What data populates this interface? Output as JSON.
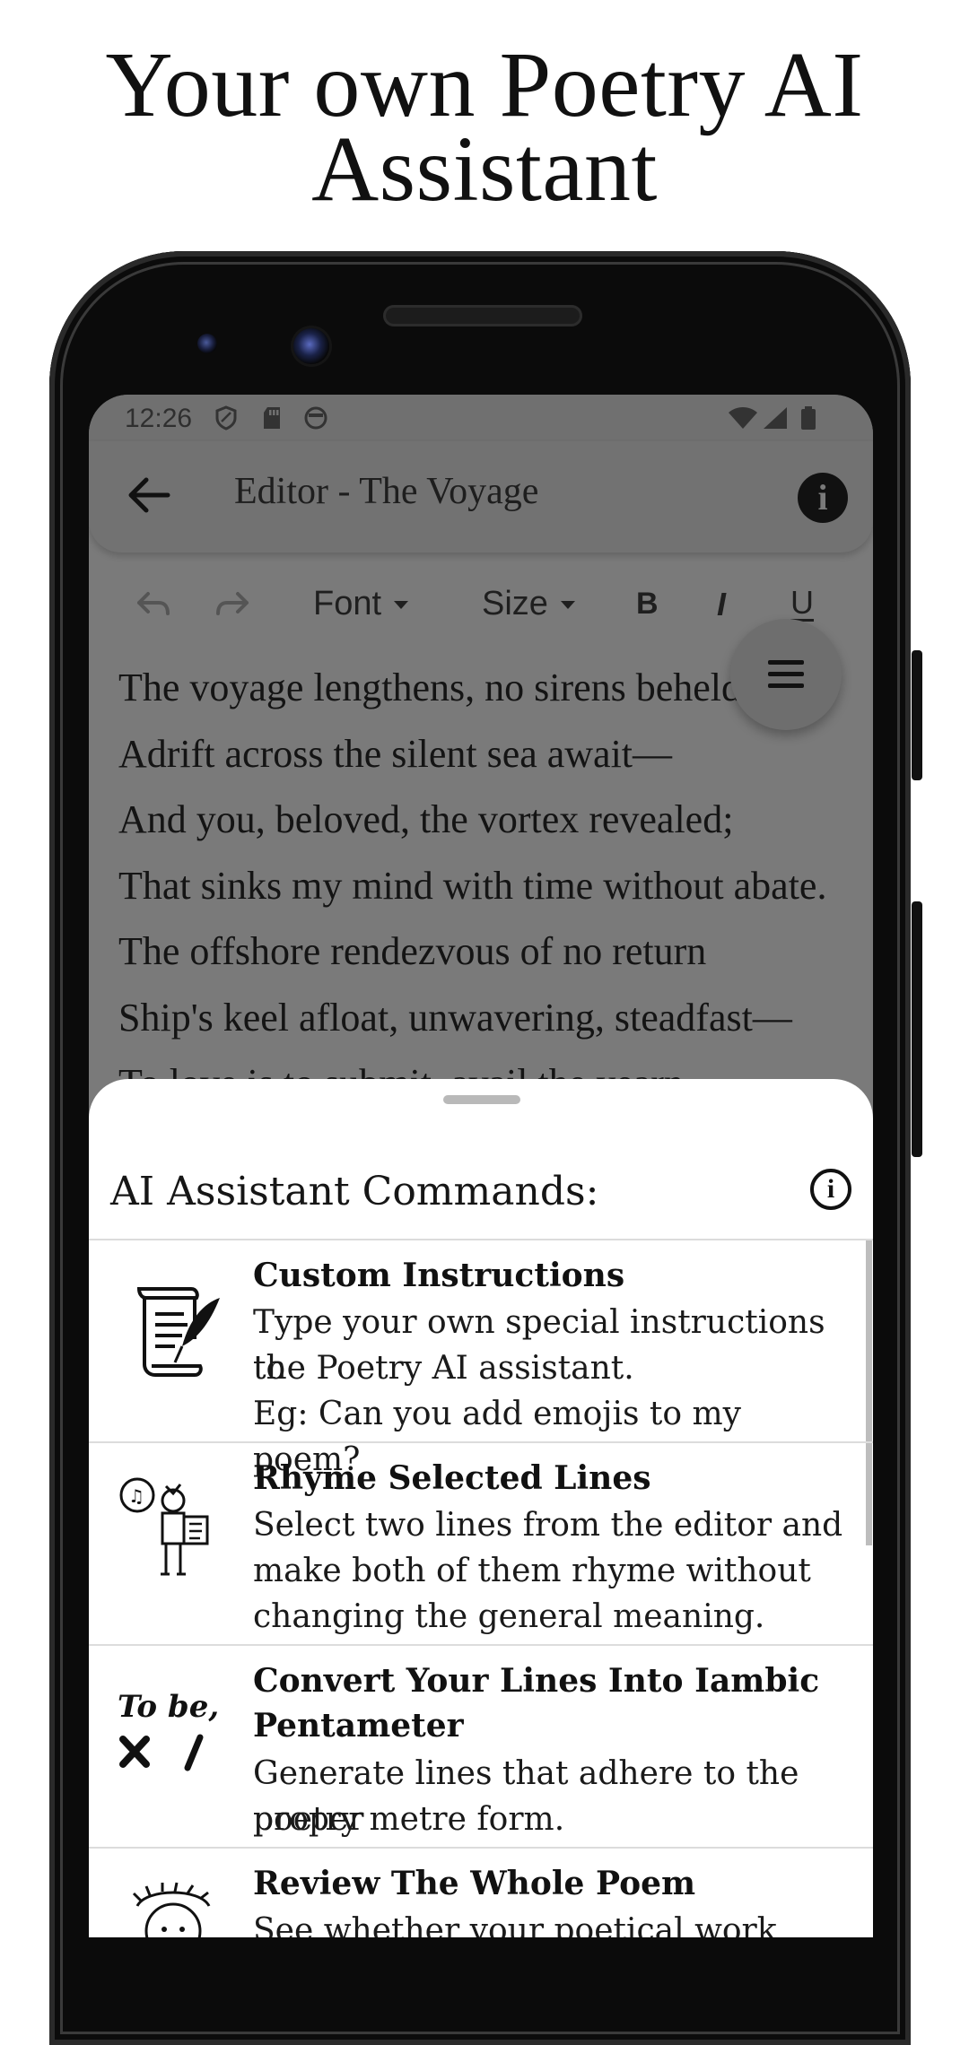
{
  "headline": {
    "line1": "Your own Poetry AI",
    "line2": "Assistant"
  },
  "status_bar": {
    "time": "12:26"
  },
  "app_bar": {
    "title": "Editor - The Voyage",
    "info_glyph": "i"
  },
  "toolbar": {
    "font_label": "Font",
    "size_label": "Size",
    "bold": "B",
    "italic": "I",
    "underline": "U"
  },
  "poem_lines": [
    "The voyage lengthens, no sirens beheld",
    "Adrift across the silent sea await—",
    "And you, beloved, the vortex revealed;",
    "That sinks my mind with time without abate.",
    "The offshore rendezvous of no return",
    "Ship's keel afloat, unwavering, steadfast—",
    "To love is to submit, avail the yearn"
  ],
  "sheet": {
    "title": "AI Assistant Commands:",
    "info_glyph": "i",
    "commands": [
      {
        "name": "Custom Instructions",
        "desc1": "Type your own special instructions to",
        "desc2": "the Poetry AI assistant.",
        "desc3": "Eg: Can you add emojis to my poem?",
        "icon": "scroll-quill-icon"
      },
      {
        "name": "Rhyme Selected Lines",
        "desc1": "Select two lines from the editor and",
        "desc2": "make both of them rhyme without",
        "desc3": "changing the general meaning.",
        "icon": "poet-reading-icon"
      },
      {
        "name1": "Convert Your Lines Into Iambic",
        "name2": "Pentameter",
        "desc1": "Generate lines that adhere to the proper",
        "desc2": "poetry metre form.",
        "icon": "to-be-icon",
        "icon_text": "To be,"
      },
      {
        "name": "Review The Whole Poem",
        "desc1": "See whether your poetical work follows",
        "icon": "laurel-head-icon"
      }
    ]
  },
  "colors": {
    "overlay": "#7a7a7a",
    "sheet": "#ffffff",
    "ink": "#111111"
  }
}
